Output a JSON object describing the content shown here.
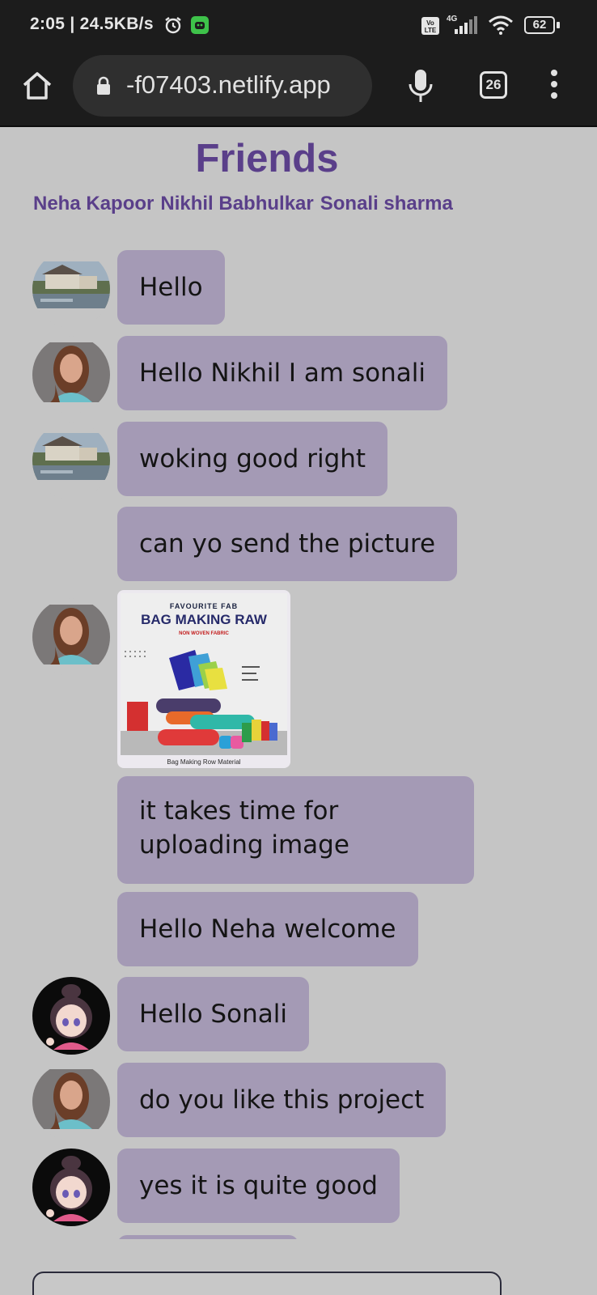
{
  "status_bar": {
    "time": "2:05 | 24.5KB/s",
    "battery": "62",
    "network": "4G",
    "icons": [
      "alarm-icon",
      "app-notification-icon",
      "volte-icon",
      "signal-icon",
      "wifi-icon",
      "battery-icon"
    ]
  },
  "browser": {
    "url": "-f07403.netlify.app",
    "tab_count": "26",
    "icons": [
      "home-icon",
      "lock-icon",
      "mic-icon",
      "tabs-icon",
      "more-vert-icon"
    ]
  },
  "page": {
    "title": "Friends",
    "members": [
      "Neha Kapoor",
      "Nikhil Babhulkar",
      "Sonali sharma"
    ]
  },
  "messages": [
    {
      "text": "Hello",
      "avatar": "house-avatar"
    },
    {
      "text": "Hello Nikhil I am sonali",
      "avatar": "woman-avatar"
    },
    {
      "text": "woking good right",
      "avatar": "house-avatar"
    },
    {
      "text": "can yo send the picture",
      "avatar": ""
    },
    {
      "image": {
        "kicker": "FAVOURITE FAB",
        "headline": "BAG MAKING RAW",
        "sub": "NON WOVEN FABRIC",
        "caption": "Bag Making Row Material"
      },
      "avatar": "woman-avatar"
    },
    {
      "text": "it takes time for uploading image",
      "avatar": ""
    },
    {
      "text": "Hello Neha welcome",
      "avatar": ""
    },
    {
      "text": "Hello Sonali",
      "avatar": "anime-girl-avatar"
    },
    {
      "text": "do you like this project",
      "avatar": "woman-avatar"
    },
    {
      "text": "yes it is quite good",
      "avatar": "anime-girl-avatar"
    }
  ],
  "colors": {
    "page_bg": "#c5c5c5",
    "bubble": "#a49ab5",
    "accent": "#5a3f8a",
    "chrome": "#1c1c1c"
  }
}
